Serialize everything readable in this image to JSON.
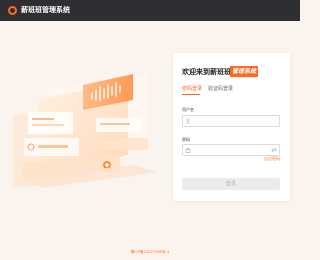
{
  "header": {
    "title": "薪班班管理系统"
  },
  "login": {
    "welcome": "欢迎来到薪班班",
    "badge": "管理系统",
    "tabs": [
      {
        "label": "密码登录",
        "active": true
      },
      {
        "label": "验证码登录",
        "active": false
      }
    ],
    "username_label": "用户名",
    "username_value": "",
    "password_label": "密码",
    "password_value": "",
    "forgot": "忘记密码",
    "submit": "登录"
  },
  "footer": {
    "icp": "蜀ICP备15027965号-3"
  },
  "colors": {
    "accent": "#ff6a1f",
    "topbar": "#2f2f33"
  }
}
